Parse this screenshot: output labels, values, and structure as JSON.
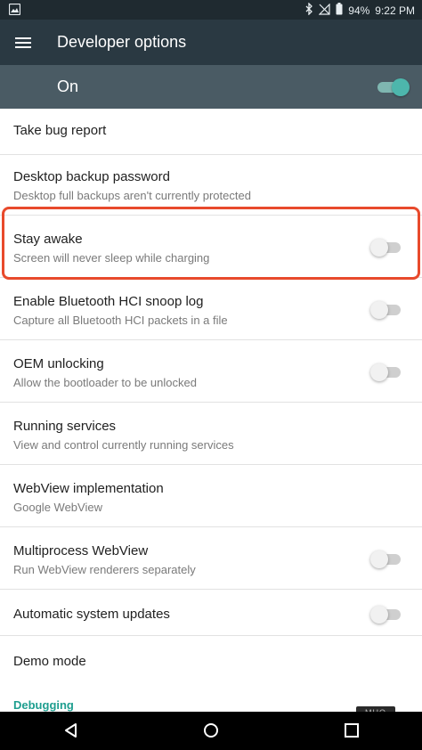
{
  "status_bar": {
    "battery": "94%",
    "time": "9:22 PM",
    "icons": [
      "image-icon",
      "bluetooth-icon",
      "no-signal-icon",
      "battery-icon"
    ]
  },
  "app_bar": {
    "title": "Developer options",
    "menu_icon": "hamburger-menu-icon"
  },
  "master_switch": {
    "label": "On",
    "state": "on",
    "accent_color": "#4db6ac"
  },
  "settings": [
    {
      "title": "Take bug report"
    },
    {
      "title": "Desktop backup password",
      "subtitle": "Desktop full backups aren't currently protected"
    },
    {
      "title": "Stay awake",
      "subtitle": "Screen will never sleep while charging",
      "toggle": "off",
      "highlighted": true
    },
    {
      "title": "Enable Bluetooth HCI snoop log",
      "subtitle": "Capture all Bluetooth HCI packets in a file",
      "toggle": "off"
    },
    {
      "title": "OEM unlocking",
      "subtitle": "Allow the bootloader to be unlocked",
      "toggle": "off"
    },
    {
      "title": "Running services",
      "subtitle": "View and control currently running services"
    },
    {
      "title": "WebView implementation",
      "subtitle": "Google WebView"
    },
    {
      "title": "Multiprocess WebView",
      "subtitle": "Run WebView renderers separately",
      "toggle": "off"
    },
    {
      "title": "Automatic system updates",
      "toggle": "off"
    },
    {
      "title": "Demo mode"
    }
  ],
  "section_header": "Debugging",
  "highlight_color": "#e84a2c",
  "nav_bar": {
    "icons": [
      "back-icon",
      "home-icon",
      "recents-icon"
    ]
  },
  "watermark": "MUO"
}
